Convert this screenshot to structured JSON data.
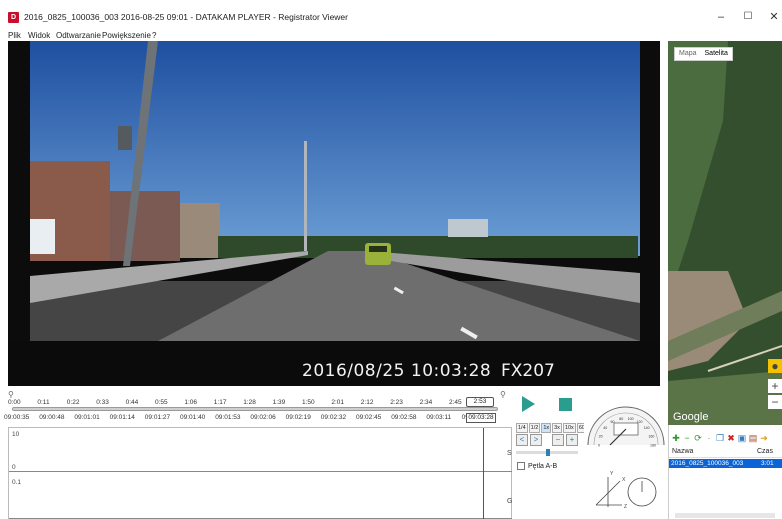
{
  "window": {
    "app_icon": "D",
    "title": "2016_0825_100036_003   2016-08-25 09:01  -  DATAKAM PLAYER - Registrator Viewer",
    "minimize": "–",
    "maximize": "☐",
    "close": "✕"
  },
  "menu": [
    "Plik",
    "Widok",
    "Odtwarzanie",
    "Powiększenie",
    "?"
  ],
  "video": {
    "osd_datetime": "2016/08/25 10:03:28",
    "osd_model": "FX207"
  },
  "map": {
    "tabs": [
      "Mapa",
      "Satelita"
    ],
    "active_tab": "Satelita",
    "provider": "Google",
    "zoom_in": "+",
    "zoom_out": "−",
    "icons": [
      "pegman-icon"
    ]
  },
  "files": {
    "toolbar_icons": [
      "add-icon",
      "remove-icon",
      "refresh-icon",
      "copy-icon",
      "delete-icon",
      "save-icon",
      "export-icon",
      "arrow-icon"
    ],
    "columns": [
      "Nazwa",
      "Czas"
    ],
    "rows": [
      {
        "name": "2016_0825_100036_003",
        "time": "3:01"
      }
    ]
  },
  "timeline": {
    "zoom_out_icon": "magnifier-minus-icon",
    "zoom_in_icon": "magnifier-plus-icon",
    "offsets": [
      "0:00",
      "0:11",
      "0:22",
      "0:33",
      "0:44",
      "0:55",
      "1:06",
      "1:17",
      "1:28",
      "1:39",
      "1:50",
      "2:01",
      "2:12",
      "2:23",
      "2:34",
      "2:45"
    ],
    "current_offset": "2:53",
    "clock_times": [
      "09:00:35",
      "09:00:48",
      "09:01:01",
      "09:01:14",
      "09:01:27",
      "09:01:40",
      "09:01:53",
      "09:02:06",
      "09:02:19",
      "09:02:32",
      "09:02:45",
      "09:02:58",
      "09:03:11",
      "09:0"
    ],
    "current_clock": "09:03:28"
  },
  "graph": {
    "top_ticks": [
      "10",
      "0"
    ],
    "bottom_ticks": [
      "0.1"
    ],
    "side_labels": [
      "S",
      "G"
    ]
  },
  "controls": {
    "speeds": [
      "1/4",
      "1/2",
      "1x",
      "3x",
      "10x",
      "60x"
    ],
    "selected_speed": "1x",
    "prev": "<",
    "next": ">",
    "zoom_out": "−",
    "zoom_in": "+",
    "loop_label": "Pętla A-B",
    "volume_level": 0.5
  },
  "gauges": {
    "speedometer_ticks": [
      "0",
      "20",
      "40",
      "60",
      "80",
      "100",
      "120",
      "140",
      "160",
      "180"
    ],
    "speed": 0,
    "accel_axes": [
      "X",
      "Y",
      "Z"
    ]
  },
  "colors": {
    "accent": "#2a9d8f",
    "selection": "#0a64d8",
    "title_icon": "#c8102e"
  }
}
